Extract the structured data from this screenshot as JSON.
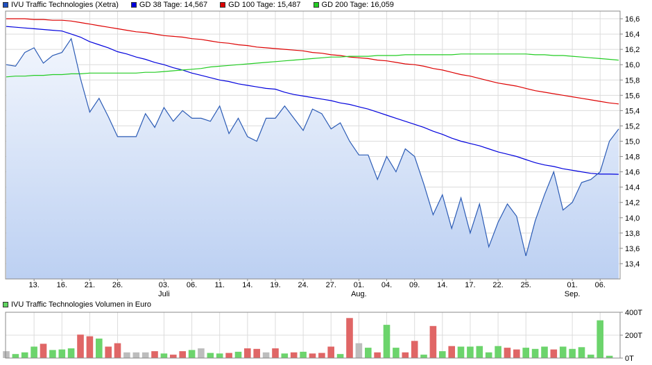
{
  "legend": [
    {
      "label": "IVU Traffic Technologies (Xetra)",
      "color": "#1f4fbf"
    },
    {
      "label": "GD 38 Tage: 14,567",
      "color": "#0000dd"
    },
    {
      "label": "GD 100 Tage: 15,487",
      "color": "#dd0000"
    },
    {
      "label": "GD 200 Tage: 16,059",
      "color": "#22cc22"
    }
  ],
  "volume_legend": {
    "label": "IVU Traffic Technologies Volumen in Euro",
    "color": "#5fd35f"
  },
  "chart_data": [
    {
      "type": "line",
      "title": "",
      "ylim": [
        13.2,
        16.7
      ],
      "y_ticks": [
        "13,4",
        "13,6",
        "13,8",
        "14,0",
        "14,2",
        "14,4",
        "14,6",
        "14,8",
        "15,0",
        "15,2",
        "15,4",
        "15,6",
        "15,8",
        "16,0",
        "16,2",
        "16,4",
        "16,6"
      ],
      "x_ticks": [
        "13.",
        "16.",
        "21.",
        "26.",
        "03.",
        "06.",
        "11.",
        "14.",
        "19.",
        "24.",
        "27.",
        "01.",
        "04.",
        "09.",
        "14.",
        "17.",
        "22.",
        "25.",
        "01.",
        "06."
      ],
      "tick_indices": [
        3,
        6,
        9,
        12,
        17,
        20,
        23,
        26,
        29,
        32,
        35,
        38,
        41,
        44,
        47,
        50,
        53,
        56,
        61,
        64
      ],
      "month_labels": [
        {
          "label": "Juli",
          "index": 17
        },
        {
          "label": "Aug.",
          "index": 38
        },
        {
          "label": "Sep.",
          "index": 61
        }
      ],
      "grid": true,
      "series": [
        {
          "name": "IVU Traffic Technologies (Xetra)",
          "color": "#2b5bb5",
          "fill": true,
          "values": [
            16.0,
            15.98,
            16.16,
            16.22,
            16.02,
            16.12,
            16.16,
            16.34,
            15.82,
            15.38,
            15.56,
            15.32,
            15.06,
            15.06,
            15.06,
            15.36,
            15.18,
            15.44,
            15.26,
            15.4,
            15.3,
            15.3,
            15.26,
            15.46,
            15.1,
            15.3,
            15.06,
            15.0,
            15.3,
            15.3,
            15.46,
            15.3,
            15.14,
            15.42,
            15.36,
            15.16,
            15.24,
            15.0,
            14.82,
            14.82,
            14.5,
            14.8,
            14.6,
            14.9,
            14.8,
            14.44,
            14.04,
            14.3,
            13.86,
            14.26,
            13.8,
            14.18,
            13.62,
            13.94,
            14.18,
            14.02,
            13.5,
            13.96,
            14.3,
            14.6,
            14.1,
            14.2,
            14.46,
            14.5,
            14.6,
            15.0,
            15.16
          ]
        },
        {
          "name": "GD 38 Tage: 14,567",
          "color": "#0000dd",
          "values": [
            16.5,
            16.49,
            16.48,
            16.47,
            16.46,
            16.45,
            16.44,
            16.4,
            16.36,
            16.3,
            16.26,
            16.22,
            16.17,
            16.14,
            16.1,
            16.07,
            16.03,
            16.0,
            15.96,
            15.93,
            15.89,
            15.86,
            15.83,
            15.8,
            15.78,
            15.75,
            15.73,
            15.71,
            15.69,
            15.68,
            15.64,
            15.61,
            15.59,
            15.57,
            15.55,
            15.53,
            15.5,
            15.48,
            15.45,
            15.42,
            15.38,
            15.34,
            15.3,
            15.26,
            15.22,
            15.18,
            15.13,
            15.09,
            15.04,
            15.0,
            14.97,
            14.94,
            14.9,
            14.86,
            14.83,
            14.8,
            14.76,
            14.72,
            14.69,
            14.67,
            14.64,
            14.62,
            14.6,
            14.58,
            14.57,
            14.57,
            14.567
          ]
        },
        {
          "name": "GD 100 Tage: 15,487",
          "color": "#dd0000",
          "values": [
            16.6,
            16.6,
            16.6,
            16.59,
            16.59,
            16.58,
            16.58,
            16.57,
            16.55,
            16.53,
            16.51,
            16.49,
            16.47,
            16.45,
            16.43,
            16.42,
            16.4,
            16.38,
            16.37,
            16.36,
            16.34,
            16.33,
            16.31,
            16.29,
            16.28,
            16.26,
            16.25,
            16.23,
            16.22,
            16.21,
            16.2,
            16.19,
            16.18,
            16.16,
            16.15,
            16.13,
            16.12,
            16.1,
            16.09,
            16.08,
            16.06,
            16.05,
            16.03,
            16.01,
            16.0,
            15.98,
            15.95,
            15.93,
            15.9,
            15.87,
            15.85,
            15.82,
            15.79,
            15.76,
            15.74,
            15.72,
            15.69,
            15.66,
            15.64,
            15.62,
            15.6,
            15.58,
            15.56,
            15.54,
            15.52,
            15.5,
            15.487
          ]
        },
        {
          "name": "GD 200 Tage: 16,059",
          "color": "#22cc22",
          "values": [
            15.84,
            15.85,
            15.85,
            15.86,
            15.86,
            15.87,
            15.87,
            15.88,
            15.88,
            15.89,
            15.89,
            15.89,
            15.89,
            15.89,
            15.89,
            15.9,
            15.9,
            15.91,
            15.92,
            15.93,
            15.94,
            15.95,
            15.97,
            15.98,
            15.99,
            16.0,
            16.01,
            16.02,
            16.03,
            16.04,
            16.05,
            16.06,
            16.07,
            16.08,
            16.09,
            16.1,
            16.1,
            16.11,
            16.11,
            16.11,
            16.12,
            16.12,
            16.12,
            16.13,
            16.13,
            16.13,
            16.13,
            16.13,
            16.13,
            16.14,
            16.14,
            16.14,
            16.14,
            16.14,
            16.14,
            16.14,
            16.14,
            16.13,
            16.13,
            16.12,
            16.12,
            16.11,
            16.1,
            16.09,
            16.08,
            16.07,
            16.059
          ]
        }
      ]
    },
    {
      "type": "bar",
      "title": "IVU Traffic Technologies Volumen in Euro",
      "ylim": [
        0,
        400
      ],
      "y_ticks": [
        "0T",
        "200T",
        "400T"
      ],
      "grid": true,
      "colors": {
        "up": "#6cd46c",
        "down": "#e06666",
        "flat": "#bdbdbd"
      },
      "values": [
        60,
        35,
        50,
        100,
        125,
        70,
        75,
        85,
        205,
        190,
        170,
        100,
        130,
        50,
        50,
        50,
        60,
        40,
        30,
        60,
        70,
        85,
        45,
        40,
        45,
        55,
        85,
        80,
        50,
        85,
        40,
        50,
        55,
        40,
        45,
        100,
        35,
        350,
        130,
        90,
        50,
        290,
        90,
        50,
        150,
        30,
        280,
        60,
        105,
        100,
        100,
        105,
        50,
        105,
        90,
        75,
        90,
        80,
        100,
        75,
        100,
        80,
        95,
        30,
        330,
        20
      ],
      "direction": [
        "flat",
        "up",
        "up",
        "up",
        "down",
        "up",
        "up",
        "up",
        "down",
        "down",
        "up",
        "down",
        "down",
        "flat",
        "flat",
        "flat",
        "down",
        "up",
        "down",
        "down",
        "up",
        "flat",
        "up",
        "up",
        "down",
        "up",
        "down",
        "down",
        "flat",
        "down",
        "up",
        "down",
        "up",
        "down",
        "down",
        "down",
        "up",
        "down",
        "flat",
        "up",
        "down",
        "up",
        "up",
        "down",
        "down",
        "up",
        "down",
        "up",
        "down",
        "up",
        "up",
        "up",
        "up",
        "up",
        "down",
        "down",
        "up",
        "up",
        "up",
        "down",
        "up",
        "up",
        "up",
        "up",
        "up",
        "up"
      ]
    }
  ]
}
